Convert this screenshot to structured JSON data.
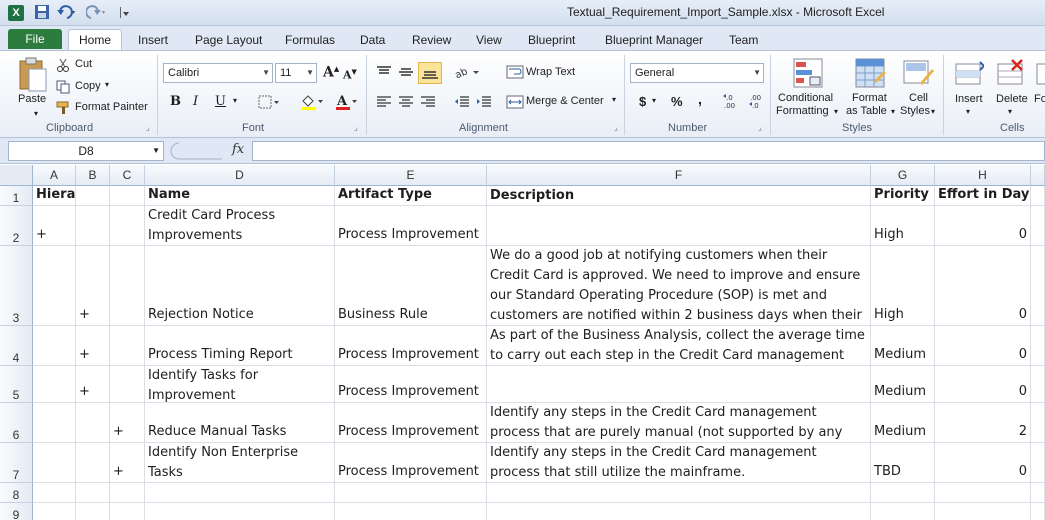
{
  "window": {
    "title": "Textual_Requirement_Import_Sample.xlsx  -  Microsoft Excel"
  },
  "quick_access": {
    "app_icon": "X",
    "icons": [
      "save-icon",
      "undo-icon",
      "redo-icon",
      "customize-icon"
    ]
  },
  "ribbon_tabs": [
    "File",
    "Home",
    "Insert",
    "Page Layout",
    "Formulas",
    "Data",
    "Review",
    "View",
    "Blueprint",
    "Blueprint Manager",
    "Team"
  ],
  "clipboard": {
    "paste": "Paste",
    "cut": "Cut",
    "copy": "Copy",
    "format_painter": "Format Painter",
    "label": "Clipboard"
  },
  "font": {
    "name": "Calibri",
    "size": "11",
    "label": "Font"
  },
  "alignment": {
    "wrap_text": "Wrap Text",
    "merge_center": "Merge & Center",
    "label": "Alignment"
  },
  "number": {
    "format": "General",
    "currency": "$",
    "percent": "%",
    "comma": ",",
    "label": "Number"
  },
  "styles": {
    "conditional_1": "Conditional",
    "conditional_2": "Formatting",
    "format_table_1": "Format",
    "format_table_2": "as Table",
    "cell_styles_1": "Cell",
    "cell_styles_2": "Styles",
    "label": "Styles"
  },
  "cells_group": {
    "insert": "Insert",
    "delete": "Delete",
    "format": "Fo",
    "label": "Cells"
  },
  "formula_bar": {
    "name_box": "D8",
    "fx": "fx",
    "value": ""
  },
  "columns": [
    "A",
    "B",
    "C",
    "D",
    "E",
    "F",
    "G",
    "H"
  ],
  "rows": [
    {
      "num": "1",
      "a": "Hierarchy",
      "b": "",
      "c": "",
      "d": "Name",
      "e": "Artifact Type",
      "f": "Description",
      "g": "Priority",
      "h": "Effort in Days"
    },
    {
      "num": "2",
      "a": "+",
      "b": "",
      "c": "",
      "d": "Credit Card Process Improvements",
      "e": "Process Improvement",
      "f": "",
      "g": "High",
      "h": "0"
    },
    {
      "num": "3",
      "a": "",
      "b": "+",
      "c": "",
      "d": "Rejection Notice",
      "e": "Business Rule",
      "f": "We do a good job at notifying customers when their Credit Card is approved. We need to improve and ensure our Standard Operating Procedure (SOP) is met and customers are notified within 2 business days when their Credit Card",
      "g": "High",
      "h": "0"
    },
    {
      "num": "4",
      "a": "",
      "b": "+",
      "c": "",
      "d": "Process Timing Report",
      "e": "Process Improvement",
      "f": "As part of the Business Analysis, collect the average time to carry out each step in the Credit Card management process",
      "g": "Medium",
      "h": "0"
    },
    {
      "num": "5",
      "a": "",
      "b": "+",
      "c": "",
      "d": "Identify Tasks for Improvement",
      "e": "Process Improvement",
      "f": "",
      "g": "Medium",
      "h": "0"
    },
    {
      "num": "6",
      "a": "",
      "b": "",
      "c": "+",
      "d": "Reduce Manual Tasks",
      "e": "Process Improvement",
      "f": "Identify any steps in the Credit Card management process that are purely manual (not supported by any bank",
      "g": "Medium",
      "h": "2"
    },
    {
      "num": "7",
      "a": "",
      "b": "",
      "c": "+",
      "d": "Identify Non Enterprise Tasks",
      "e": "Process Improvement",
      "f": "Identify any steps in the Credit Card management process that still utilize the mainframe.",
      "g": "TBD",
      "h": "0"
    },
    {
      "num": "8",
      "a": "",
      "b": "",
      "c": "",
      "d": "",
      "e": "",
      "f": "",
      "g": "",
      "h": ""
    },
    {
      "num": "9",
      "a": "",
      "b": "",
      "c": "",
      "d": "",
      "e": "",
      "f": "",
      "g": "",
      "h": ""
    }
  ]
}
